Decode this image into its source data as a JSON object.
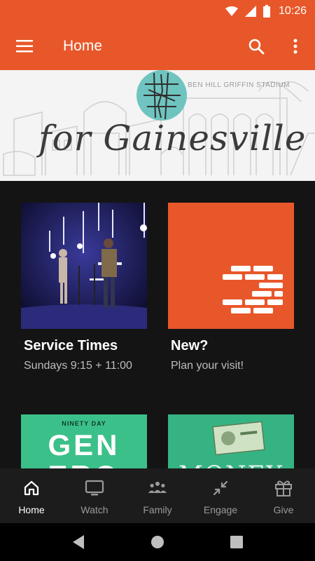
{
  "colors": {
    "brand": "#e8572a",
    "background": "#141414",
    "nav_background": "#1c1c1c",
    "text_muted": "#bdbdbd"
  },
  "status_bar": {
    "time": "10:26",
    "icons": [
      "wifi-icon",
      "cellular-signal-icon",
      "battery-icon"
    ]
  },
  "app_bar": {
    "title": "Home",
    "icons": [
      "menu-icon",
      "search-icon",
      "more-vert-icon"
    ]
  },
  "banner": {
    "script_text": "for Gainesville",
    "stadium_text": "BEN HILL GRIFFIN STADIUM"
  },
  "cards": [
    {
      "title": "Service Times",
      "subtitle": "Sundays 9:15 + 11:00",
      "image": "worship-stage-photo"
    },
    {
      "title": "New?",
      "subtitle": "Plan your visit!",
      "image": "brick-logo-icon"
    },
    {
      "title": "",
      "subtitle": "",
      "image": "generosity-artwork",
      "image_small_text": "NINETY DAY",
      "image_big_text": "GEN ERO"
    },
    {
      "title": "",
      "subtitle": "",
      "image": "money-artwork",
      "image_big_text": "MONEY"
    }
  ],
  "bottom_nav": [
    {
      "label": "Home",
      "icon": "home-icon",
      "active": true
    },
    {
      "label": "Watch",
      "icon": "tv-icon",
      "active": false
    },
    {
      "label": "Family",
      "icon": "family-icon",
      "active": false
    },
    {
      "label": "Engage",
      "icon": "engage-arrows-icon",
      "active": false
    },
    {
      "label": "Give",
      "icon": "gift-icon",
      "active": false
    }
  ],
  "system_nav": [
    "back-icon",
    "home-circle-icon",
    "recents-icon"
  ]
}
